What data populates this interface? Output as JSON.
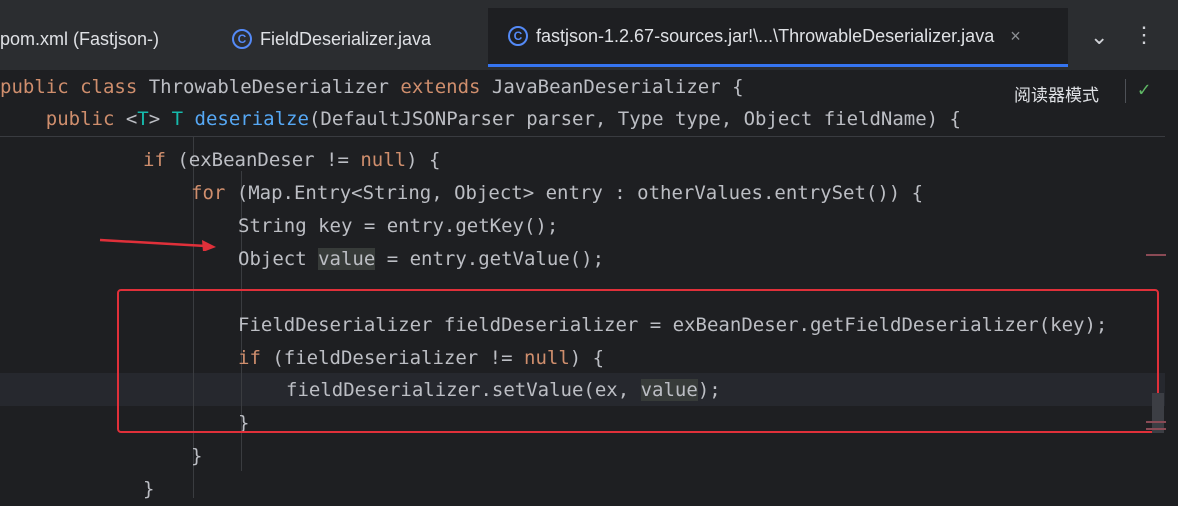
{
  "tabs": [
    {
      "label": "pom.xml (Fastjson-)",
      "icon": "none"
    },
    {
      "label": "FieldDeserializer.java",
      "icon": "java-class-icon"
    },
    {
      "label": "fastjson-1.2.67-sources.jar!\\...\\ThrowableDeserializer.java",
      "icon": "java-class-icon",
      "active": true,
      "close": "×"
    }
  ],
  "toolbar": {
    "more_tabs": "⌄",
    "menu": "⋮"
  },
  "reader_mode": "阅读器模式",
  "inspection_icon": "✓",
  "sticky_lines": [
    "public class ThrowableDeserializer extends JavaBeanDeserializer {",
    "    public <T> T deserialze(DefaultJSONParser parser, Type type, Object fieldName) {"
  ],
  "code": {
    "l1": "if (exBeanDeser != null) {",
    "l2": "for (Map.Entry<String, Object> entry : otherValues.entrySet()) {",
    "l3": "String key = entry.getKey();",
    "l4": "Object value = entry.getValue();",
    "l5": "FieldDeserializer fieldDeserializer = exBeanDeser.getFieldDeserializer(key);",
    "l6": "if (fieldDeserializer != null) {",
    "l7": "fieldDeserializer.setValue(ex, value);",
    "l8": "}",
    "l9": "}",
    "l10": "}"
  },
  "colors": {
    "keyword": "#cf8e6d",
    "function": "#56a8f5",
    "type_param": "#16baac",
    "annotation_red": "#e0303a"
  }
}
